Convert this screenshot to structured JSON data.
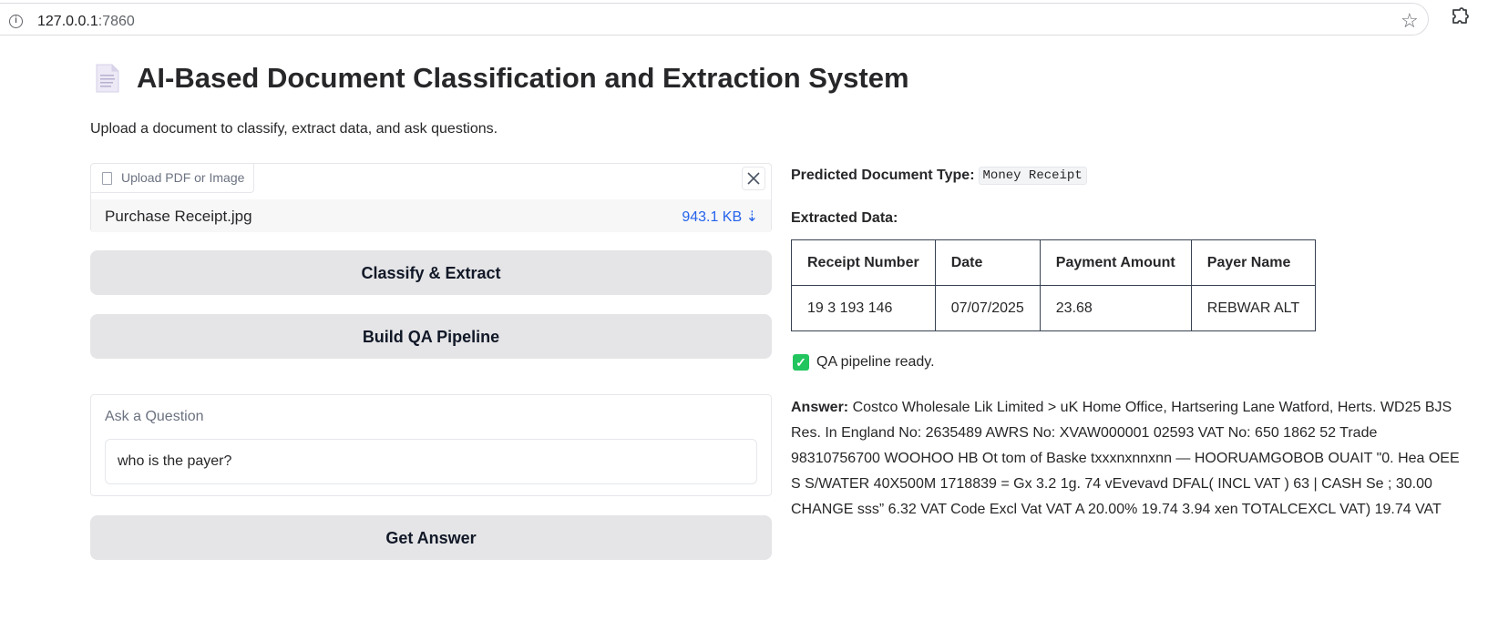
{
  "browser": {
    "url_host": "127.0.0.1",
    "url_port": ":7860"
  },
  "page": {
    "title": "AI-Based Document Classification and Extraction System",
    "subtitle": "Upload a document to classify, extract data, and ask questions."
  },
  "upload": {
    "label": "Upload PDF or Image",
    "file_name": "Purchase Receipt.jpg",
    "file_size": "943.1 KB ⇣"
  },
  "buttons": {
    "classify": "Classify & Extract",
    "build_qa": "Build QA Pipeline",
    "get_answer": "Get Answer"
  },
  "question": {
    "label": "Ask a Question",
    "value": "who is the payer?"
  },
  "results": {
    "predicted_label": "Predicted Document Type:",
    "predicted_value": "Money Receipt",
    "extracted_label": "Extracted Data:",
    "table": {
      "headers": [
        "Receipt Number",
        "Date",
        "Payment Amount",
        "Payer Name"
      ],
      "row": [
        "19 3 193 146",
        "07/07/2025",
        "23.68",
        "REBWAR ALT"
      ]
    },
    "status": "QA pipeline ready.",
    "answer_label": "Answer:",
    "answer_text": "Costco Wholesale Lik Limited > uK Home Office, Hartsering Lane Watford, Herts. WD25 BJS Res. In England No: 2635489 AWRS No: XVAW000001 02593 VAT No: 650 1862 52 Trade 98310756700 WOOHOO HB Ot tom of Baske txxxnxnnxnn — HOORUAMGOBOB OUAIT \"0. Hea OEE S S/WATER 40X500M 1718839 = Gx 3.2 1g. 74 vEvevavd DFAL( INCL VAT ) 63 | CASH Se ; 30.00 CHANGE sss” 6.32 VAT Code Excl Vat VAT A 20.00% 19.74 3.94 xen TOTALCEXCL VAT) 19.74 VAT"
  },
  "icons": {
    "info": "info-icon",
    "star": "star-icon",
    "extensions": "puzzle-icon",
    "document": "document-icon",
    "file": "file-icon",
    "close": "close-icon",
    "check": "check-icon"
  }
}
